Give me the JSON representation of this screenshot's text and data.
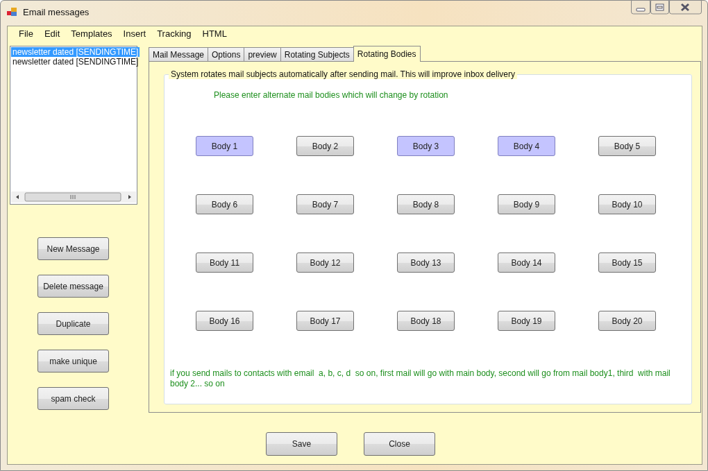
{
  "window": {
    "title": "Email messages"
  },
  "menu": [
    "File",
    "Edit",
    "Templates",
    "Insert",
    "Tracking",
    "HTML"
  ],
  "messages": [
    {
      "label": "newsletter dated [SENDINGTIME]",
      "selected": true
    },
    {
      "label": "newsletter dated [SENDINGTIME]",
      "selected": false
    }
  ],
  "side_buttons": [
    "New Message",
    "Delete message",
    "Duplicate",
    "make unique",
    "spam check"
  ],
  "tabs": [
    {
      "label": "Mail Message",
      "selected": false
    },
    {
      "label": "Options",
      "selected": false
    },
    {
      "label": "preview",
      "selected": false
    },
    {
      "label": "Rotating Subjects",
      "selected": false
    },
    {
      "label": "Rotating Bodies",
      "selected": true
    }
  ],
  "group": {
    "title": "System rotates mail subjects automatically after sending mail. This will improve inbox delivery",
    "hint": "Please enter alternate mail bodies which will change by rotation",
    "note": "if you send mails to contacts with email  a, b, c, d  so on, first mail will go with main body, second will go from mail body1, third  with mail body 2... so on"
  },
  "bodies": [
    {
      "label": "Body 1",
      "filled": true
    },
    {
      "label": "Body 2",
      "filled": false
    },
    {
      "label": "Body 3",
      "filled": true
    },
    {
      "label": "Body 4",
      "filled": true
    },
    {
      "label": "Body 5",
      "filled": false
    },
    {
      "label": "Body 6",
      "filled": false
    },
    {
      "label": "Body 7",
      "filled": false
    },
    {
      "label": "Body 8",
      "filled": false
    },
    {
      "label": "Body 9",
      "filled": false
    },
    {
      "label": "Body 10",
      "filled": false
    },
    {
      "label": "Body 11",
      "filled": false
    },
    {
      "label": "Body 12",
      "filled": false
    },
    {
      "label": "Body 13",
      "filled": false
    },
    {
      "label": "Body 14",
      "filled": false
    },
    {
      "label": "Body 15",
      "filled": false
    },
    {
      "label": "Body 16",
      "filled": false
    },
    {
      "label": "Body 17",
      "filled": false
    },
    {
      "label": "Body 18",
      "filled": false
    },
    {
      "label": "Body 19",
      "filled": false
    },
    {
      "label": "Body 20",
      "filled": false
    }
  ],
  "footer_buttons": [
    "Save",
    "Close"
  ]
}
